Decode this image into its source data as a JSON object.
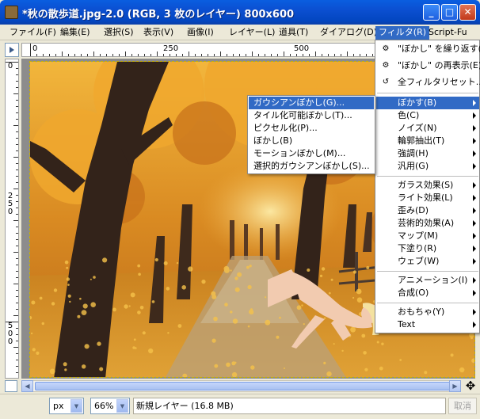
{
  "window": {
    "title": "*秋の散歩道.jpg-2.0 (RGB, 3 枚のレイヤー) 800x600",
    "minimize_glyph": "_",
    "maximize_glyph": "□",
    "close_glyph": "✕"
  },
  "menubar": {
    "items": [
      {
        "label": "ファイル(F)"
      },
      {
        "label": "編集(E)"
      },
      {
        "label": "選択(S)"
      },
      {
        "label": "表示(V)"
      },
      {
        "label": "画像(I)"
      },
      {
        "label": "レイヤー(L)"
      },
      {
        "label": "道具(T)"
      },
      {
        "label": "ダイアログ(D)"
      },
      {
        "label": "フィルタ(R)"
      },
      {
        "label": "Script-Fu"
      }
    ],
    "active_index": 8
  },
  "rulers": {
    "horizontal_labels": [
      "0",
      "250",
      "500"
    ],
    "vertical_labels": [
      "0",
      "250",
      "500"
    ]
  },
  "filter_menu": {
    "top_items": [
      {
        "label": "\"ぼかし\" を繰り返す(F)",
        "icon": "repeat-icon"
      },
      {
        "label": "\"ぼかし\" の再表示(E)",
        "icon": "reshow-icon"
      },
      {
        "label": "全フィルタリセット...",
        "icon": "reset-icon"
      }
    ],
    "groups": [
      [
        "ぼかす(B)",
        "色(C)",
        "ノイズ(N)",
        "輪郭抽出(T)",
        "強調(H)",
        "汎用(G)"
      ],
      [
        "ガラス効果(S)",
        "ライト効果(L)",
        "歪み(D)",
        "芸術的効果(A)",
        "マップ(M)",
        "下塗り(R)",
        "ウェブ(W)"
      ],
      [
        "アニメーション(I)",
        "合成(O)"
      ],
      [
        "おもちゃ(Y)",
        "Text"
      ]
    ],
    "highlighted": "ぼかす(B)"
  },
  "blur_submenu": {
    "items": [
      "ガウシアンぼかし(G)...",
      "タイル化可能ぼかし(T)...",
      "ピクセル化(P)...",
      "ぼかし(B)",
      "モーションぼかし(M)...",
      "選択的ガウシアンぼかし(S)..."
    ],
    "highlighted_index": 0
  },
  "statusbar": {
    "unit": "px",
    "zoom": "66%",
    "message": "新規レイヤー (16.8 MB)",
    "cancel_label": "取消"
  },
  "colors": {
    "titlebar": "#0a5ee0",
    "highlight": "#316ac5",
    "autumn_leaves": "#e8a23a",
    "tree_trunk": "#3a2a1e"
  }
}
